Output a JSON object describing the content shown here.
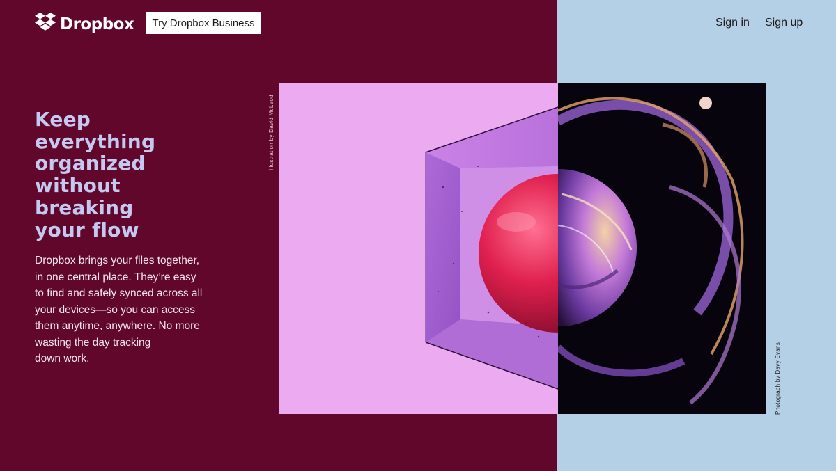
{
  "header": {
    "logo_text": "Dropbox",
    "try_business_label": "Try Dropbox Business",
    "sign_in_label": "Sign in",
    "sign_up_label": "Sign up"
  },
  "hero": {
    "headline_lines": [
      "Keep",
      "everything",
      "organized",
      "without",
      "breaking",
      "your flow"
    ],
    "body_lines": [
      "Dropbox brings your files together,",
      "in one central place. They’re easy",
      "to find and safely synced across all",
      "your devices—so you can access",
      "them anytime, anywhere. No more",
      "wasting the day tracking",
      "down work."
    ]
  },
  "credits": {
    "illustration": "Illustration by David McLeod",
    "photo": "Photograph by Davy Evans"
  },
  "colors": {
    "left_background": "#61072c",
    "right_background": "#b4d0e7",
    "headline": "#c5c8f0",
    "illustration_background": "#ecaaf0",
    "photo_background": "#07040d"
  }
}
